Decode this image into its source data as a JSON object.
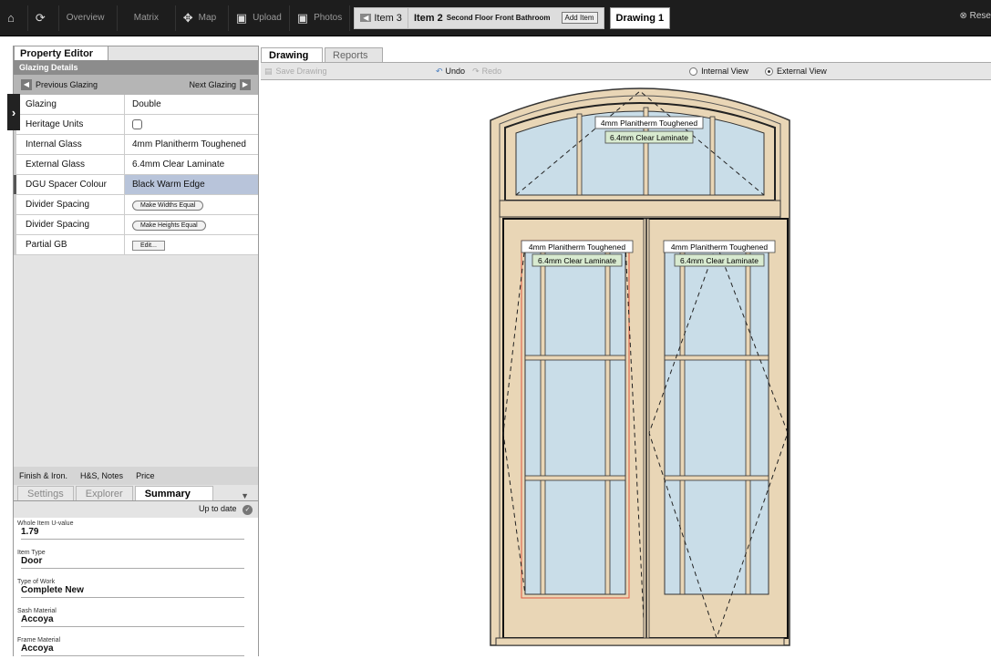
{
  "topbar": {
    "home_icon": "home-icon",
    "refresh_icon": "refresh-icon",
    "overview": "Overview",
    "matrix": "Matrix",
    "map": "Map",
    "upload": "Upload",
    "photos": "Photos",
    "item3": "Item 3",
    "item2": "Item 2",
    "item2_sub": "Second Floor Front Bathroom",
    "add_item": "Add Item",
    "drawing": "Drawing 1",
    "reset": "Rese"
  },
  "left": {
    "tab": "Property Editor",
    "section": "Glazing Details",
    "prev": "Previous Glazing",
    "next": "Next Glazing",
    "rows": [
      {
        "key": "Glazing",
        "value": "Double"
      },
      {
        "key": "Heritage Units",
        "value": ""
      },
      {
        "key": "Internal Glass",
        "value": "4mm Planitherm Toughened"
      },
      {
        "key": "External Glass",
        "value": "6.4mm Clear Laminate"
      },
      {
        "key": "DGU Spacer Colour",
        "value": "Black Warm Edge"
      },
      {
        "key": "Divider Spacing",
        "value": "Make Widths Equal"
      },
      {
        "key": "Divider Spacing",
        "value": "Make Heights Equal"
      },
      {
        "key": "Partial GB",
        "value": "Edit..."
      }
    ],
    "footer_tabs": [
      "Finish & Iron.",
      "H&S, Notes",
      "Price"
    ],
    "sub_tabs": [
      "Settings",
      "Explorer",
      "Summary"
    ],
    "status": "Up to date",
    "summary": [
      {
        "label": "Whole Item U-value",
        "value": "1.79"
      },
      {
        "label": "Item Type",
        "value": "Door"
      },
      {
        "label": "Type of Work",
        "value": "Complete New"
      },
      {
        "label": "Sash Material",
        "value": "Accoya"
      },
      {
        "label": "Frame Material",
        "value": "Accoya"
      }
    ]
  },
  "main": {
    "tabs": [
      "Drawing",
      "Reports"
    ],
    "save": "Save Drawing",
    "undo": "Undo",
    "redo": "Redo",
    "internal_view": "Internal View",
    "external_view": "External View",
    "glass_internal": "4mm Planitherm Toughened",
    "glass_external": "6.4mm Clear Laminate"
  },
  "colors": {
    "frame": "#e9d6b6",
    "glass": "#c9dde8",
    "selected_row": "#b8c4da",
    "selected_pane_outline": "#e0553d"
  }
}
